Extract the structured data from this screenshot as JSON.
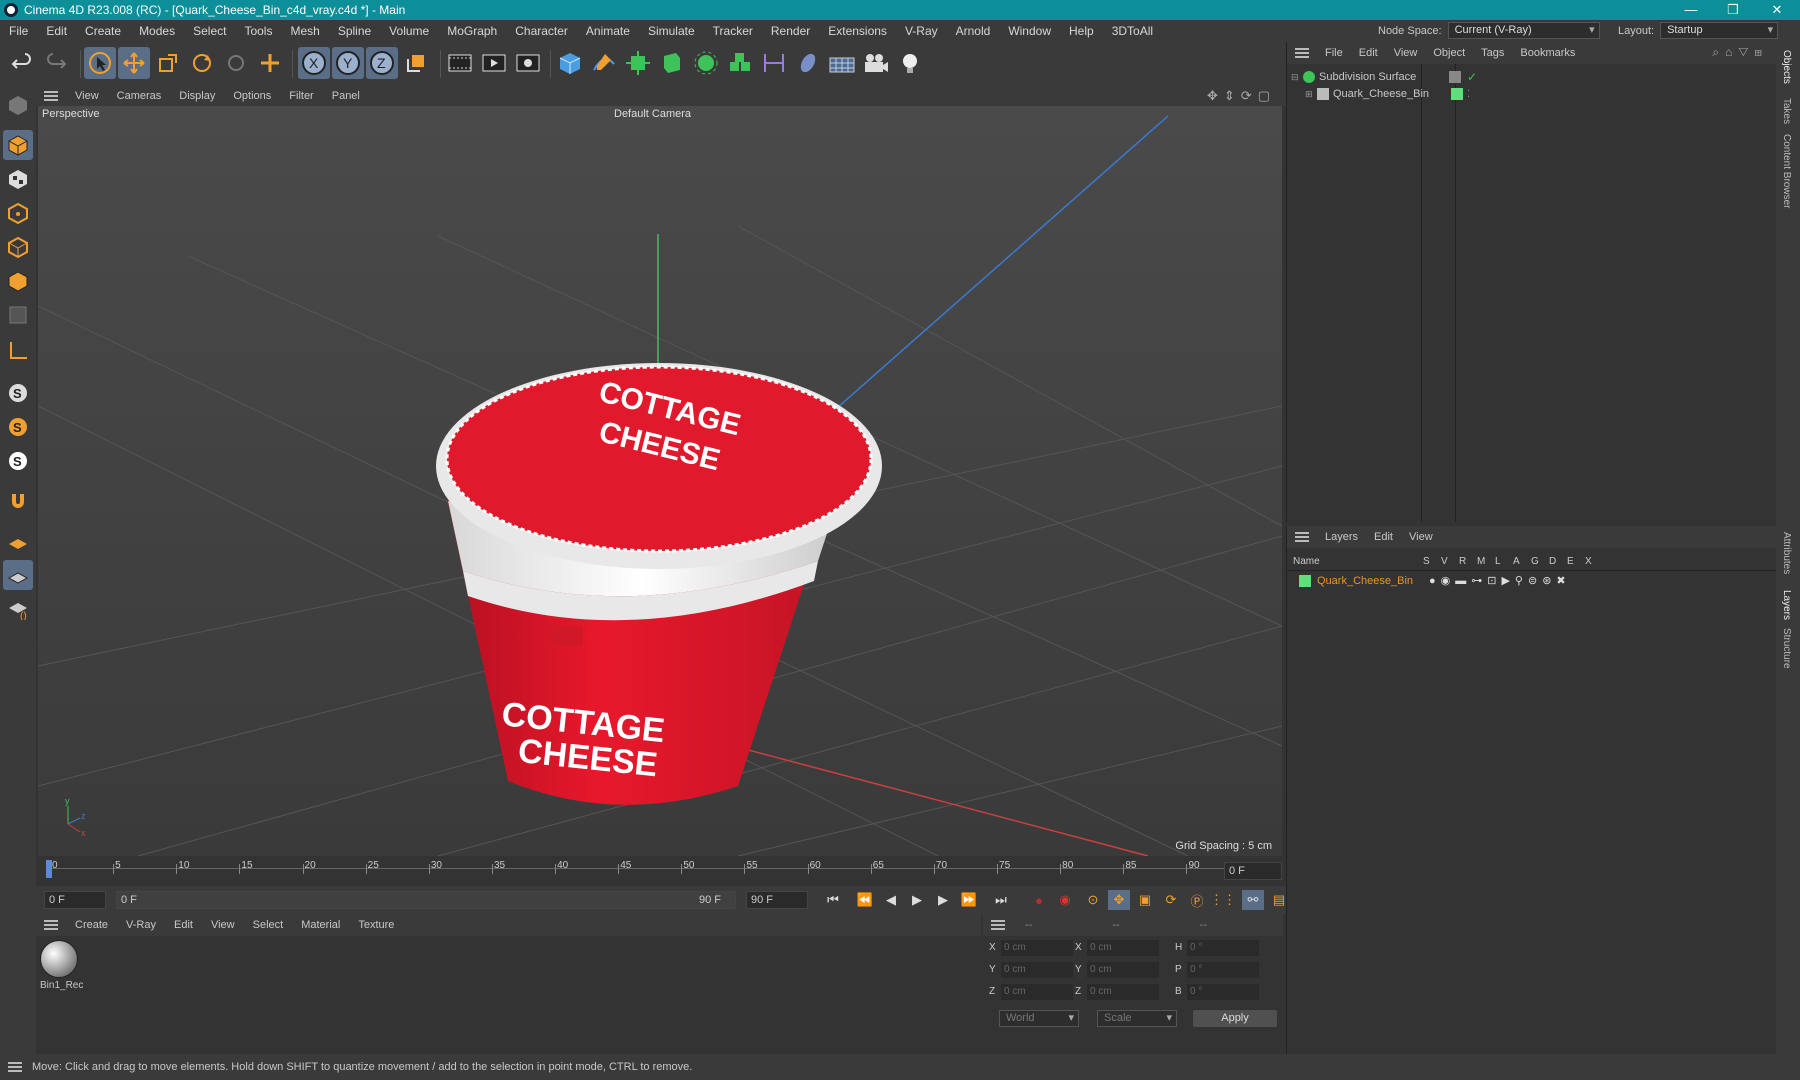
{
  "window": {
    "title": "Cinema 4D R23.008 (RC) - [Quark_Cheese_Bin_c4d_vray.c4d *] - Main",
    "minimize": "—",
    "maximize": "❐",
    "close": "✕"
  },
  "menu": [
    "File",
    "Edit",
    "Create",
    "Modes",
    "Select",
    "Tools",
    "Mesh",
    "Spline",
    "Volume",
    "MoGraph",
    "Character",
    "Animate",
    "Simulate",
    "Tracker",
    "Render",
    "Extensions",
    "V-Ray",
    "Arnold",
    "Window",
    "Help",
    "3DToAll"
  ],
  "node_space": {
    "label": "Node Space:",
    "value": "Current (V-Ray)"
  },
  "layout": {
    "label": "Layout:",
    "value": "Startup"
  },
  "viewport_menu": [
    "View",
    "Cameras",
    "Display",
    "Options",
    "Filter",
    "Panel"
  ],
  "viewport": {
    "name": "Perspective",
    "camera": "Default Camera",
    "grid_spacing": "Grid Spacing : 5 cm"
  },
  "timeline": {
    "ticks": [
      "0",
      "5",
      "10",
      "15",
      "20",
      "25",
      "30",
      "35",
      "40",
      "45",
      "50",
      "55",
      "60",
      "65",
      "70",
      "75",
      "80",
      "85",
      "90"
    ],
    "current_frame": "0 F"
  },
  "timebar": {
    "start": "0 F",
    "range_start": "0 F",
    "range_end": "90 F",
    "end": "90 F"
  },
  "material_menu": [
    "Create",
    "V-Ray",
    "Edit",
    "View",
    "Select",
    "Material",
    "Texture"
  ],
  "materials": [
    {
      "name": "Bin1_Rec"
    }
  ],
  "coordinates": {
    "headers": [
      "--",
      "--",
      "--"
    ],
    "rows": [
      {
        "a": "X",
        "v1": "0 cm",
        "b": "X",
        "v2": "0 cm",
        "c": "H",
        "v3": "0 °"
      },
      {
        "a": "Y",
        "v1": "0 cm",
        "b": "Y",
        "v2": "0 cm",
        "c": "P",
        "v3": "0 °"
      },
      {
        "a": "Z",
        "v1": "0 cm",
        "b": "Z",
        "v2": "0 cm",
        "c": "B",
        "v3": "0 °"
      }
    ],
    "mode1": "World",
    "mode2": "Scale",
    "apply": "Apply"
  },
  "object_menu": [
    "File",
    "Edit",
    "View",
    "Object",
    "Tags",
    "Bookmarks"
  ],
  "objects": [
    {
      "name": "Subdivision Surface"
    },
    {
      "name": "Quark_Cheese_Bin"
    }
  ],
  "layers_menu": [
    "Layers",
    "Edit",
    "View"
  ],
  "layers_columns": {
    "name": "Name",
    "flags": [
      "S",
      "V",
      "R",
      "M",
      "L",
      "A",
      "G",
      "D",
      "E",
      "X"
    ]
  },
  "layers": [
    {
      "name": "Quark_Cheese_Bin",
      "color": "#5ee07a"
    }
  ],
  "right_tabs": [
    "Objects",
    "Takes",
    "Content Browser",
    "Attributes",
    "Layers",
    "Structure"
  ],
  "status": "Move: Click and drag to move elements. Hold down SHIFT to quantize movement / add to the selection in point mode, CTRL to remove.",
  "label_text": {
    "cottage": "COTTAGE",
    "cheese": "CHEESE"
  },
  "colors": {
    "accent": "#0d8f9a",
    "layer_name": "#e8962a",
    "selection": "#5a6e88"
  }
}
